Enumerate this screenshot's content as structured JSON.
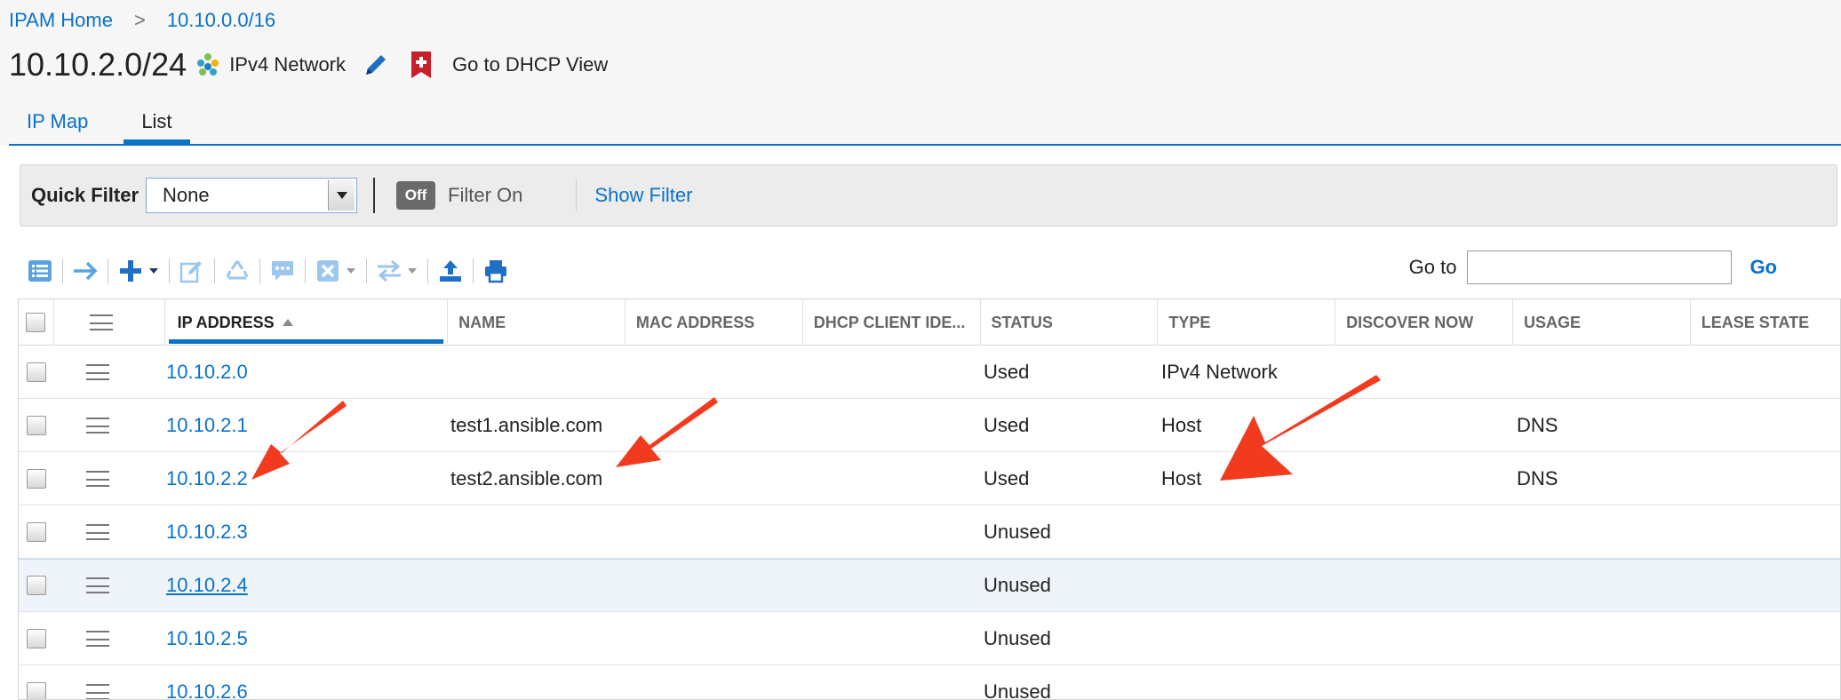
{
  "breadcrumb": {
    "home": "IPAM Home",
    "separator": ">",
    "parent": "10.10.0.0/16"
  },
  "header": {
    "title": "10.10.2.0/24",
    "type_label": "IPv4 Network",
    "dhcp_link": "Go to DHCP View"
  },
  "tabs": [
    {
      "label": "IP Map",
      "active": false
    },
    {
      "label": "List",
      "active": true
    }
  ],
  "filter": {
    "quick_filter_label": "Quick Filter",
    "quick_filter_value": "None",
    "toggle_label": "Off",
    "filter_on_label": "Filter On",
    "show_filter_label": "Show Filter"
  },
  "toolbar": {
    "icons": [
      "list-view-icon",
      "arrow-right-icon",
      "add-icon",
      "edit-icon",
      "recycle-icon",
      "comment-icon",
      "delete-icon",
      "swap-icon",
      "export-icon",
      "print-icon"
    ],
    "goto_label": "Go to",
    "goto_value": "",
    "go_button": "Go"
  },
  "grid": {
    "columns": [
      "IP ADDRESS",
      "NAME",
      "MAC ADDRESS",
      "DHCP CLIENT IDE...",
      "STATUS",
      "TYPE",
      "DISCOVER NOW",
      "USAGE",
      "LEASE STATE"
    ],
    "sorted_column": "IP ADDRESS",
    "rows": [
      {
        "ip": "10.10.2.0",
        "name": "",
        "status": "Used",
        "type": "IPv4 Network",
        "usage": ""
      },
      {
        "ip": "10.10.2.1",
        "name": "test1.ansible.com",
        "status": "Used",
        "type": "Host",
        "usage": "DNS"
      },
      {
        "ip": "10.10.2.2",
        "name": "test2.ansible.com",
        "status": "Used",
        "type": "Host",
        "usage": "DNS"
      },
      {
        "ip": "10.10.2.3",
        "name": "",
        "status": "Unused",
        "type": "",
        "usage": ""
      },
      {
        "ip": "10.10.2.4",
        "name": "",
        "status": "Unused",
        "type": "",
        "usage": ""
      },
      {
        "ip": "10.10.2.5",
        "name": "",
        "status": "Unused",
        "type": "",
        "usage": ""
      },
      {
        "ip": "10.10.2.6",
        "name": "",
        "status": "Unused",
        "type": "",
        "usage": ""
      }
    ]
  },
  "colors": {
    "link": "#0a72c9",
    "annotation_arrow": "#f23a1e",
    "highlight_row": "#eef4fa"
  }
}
